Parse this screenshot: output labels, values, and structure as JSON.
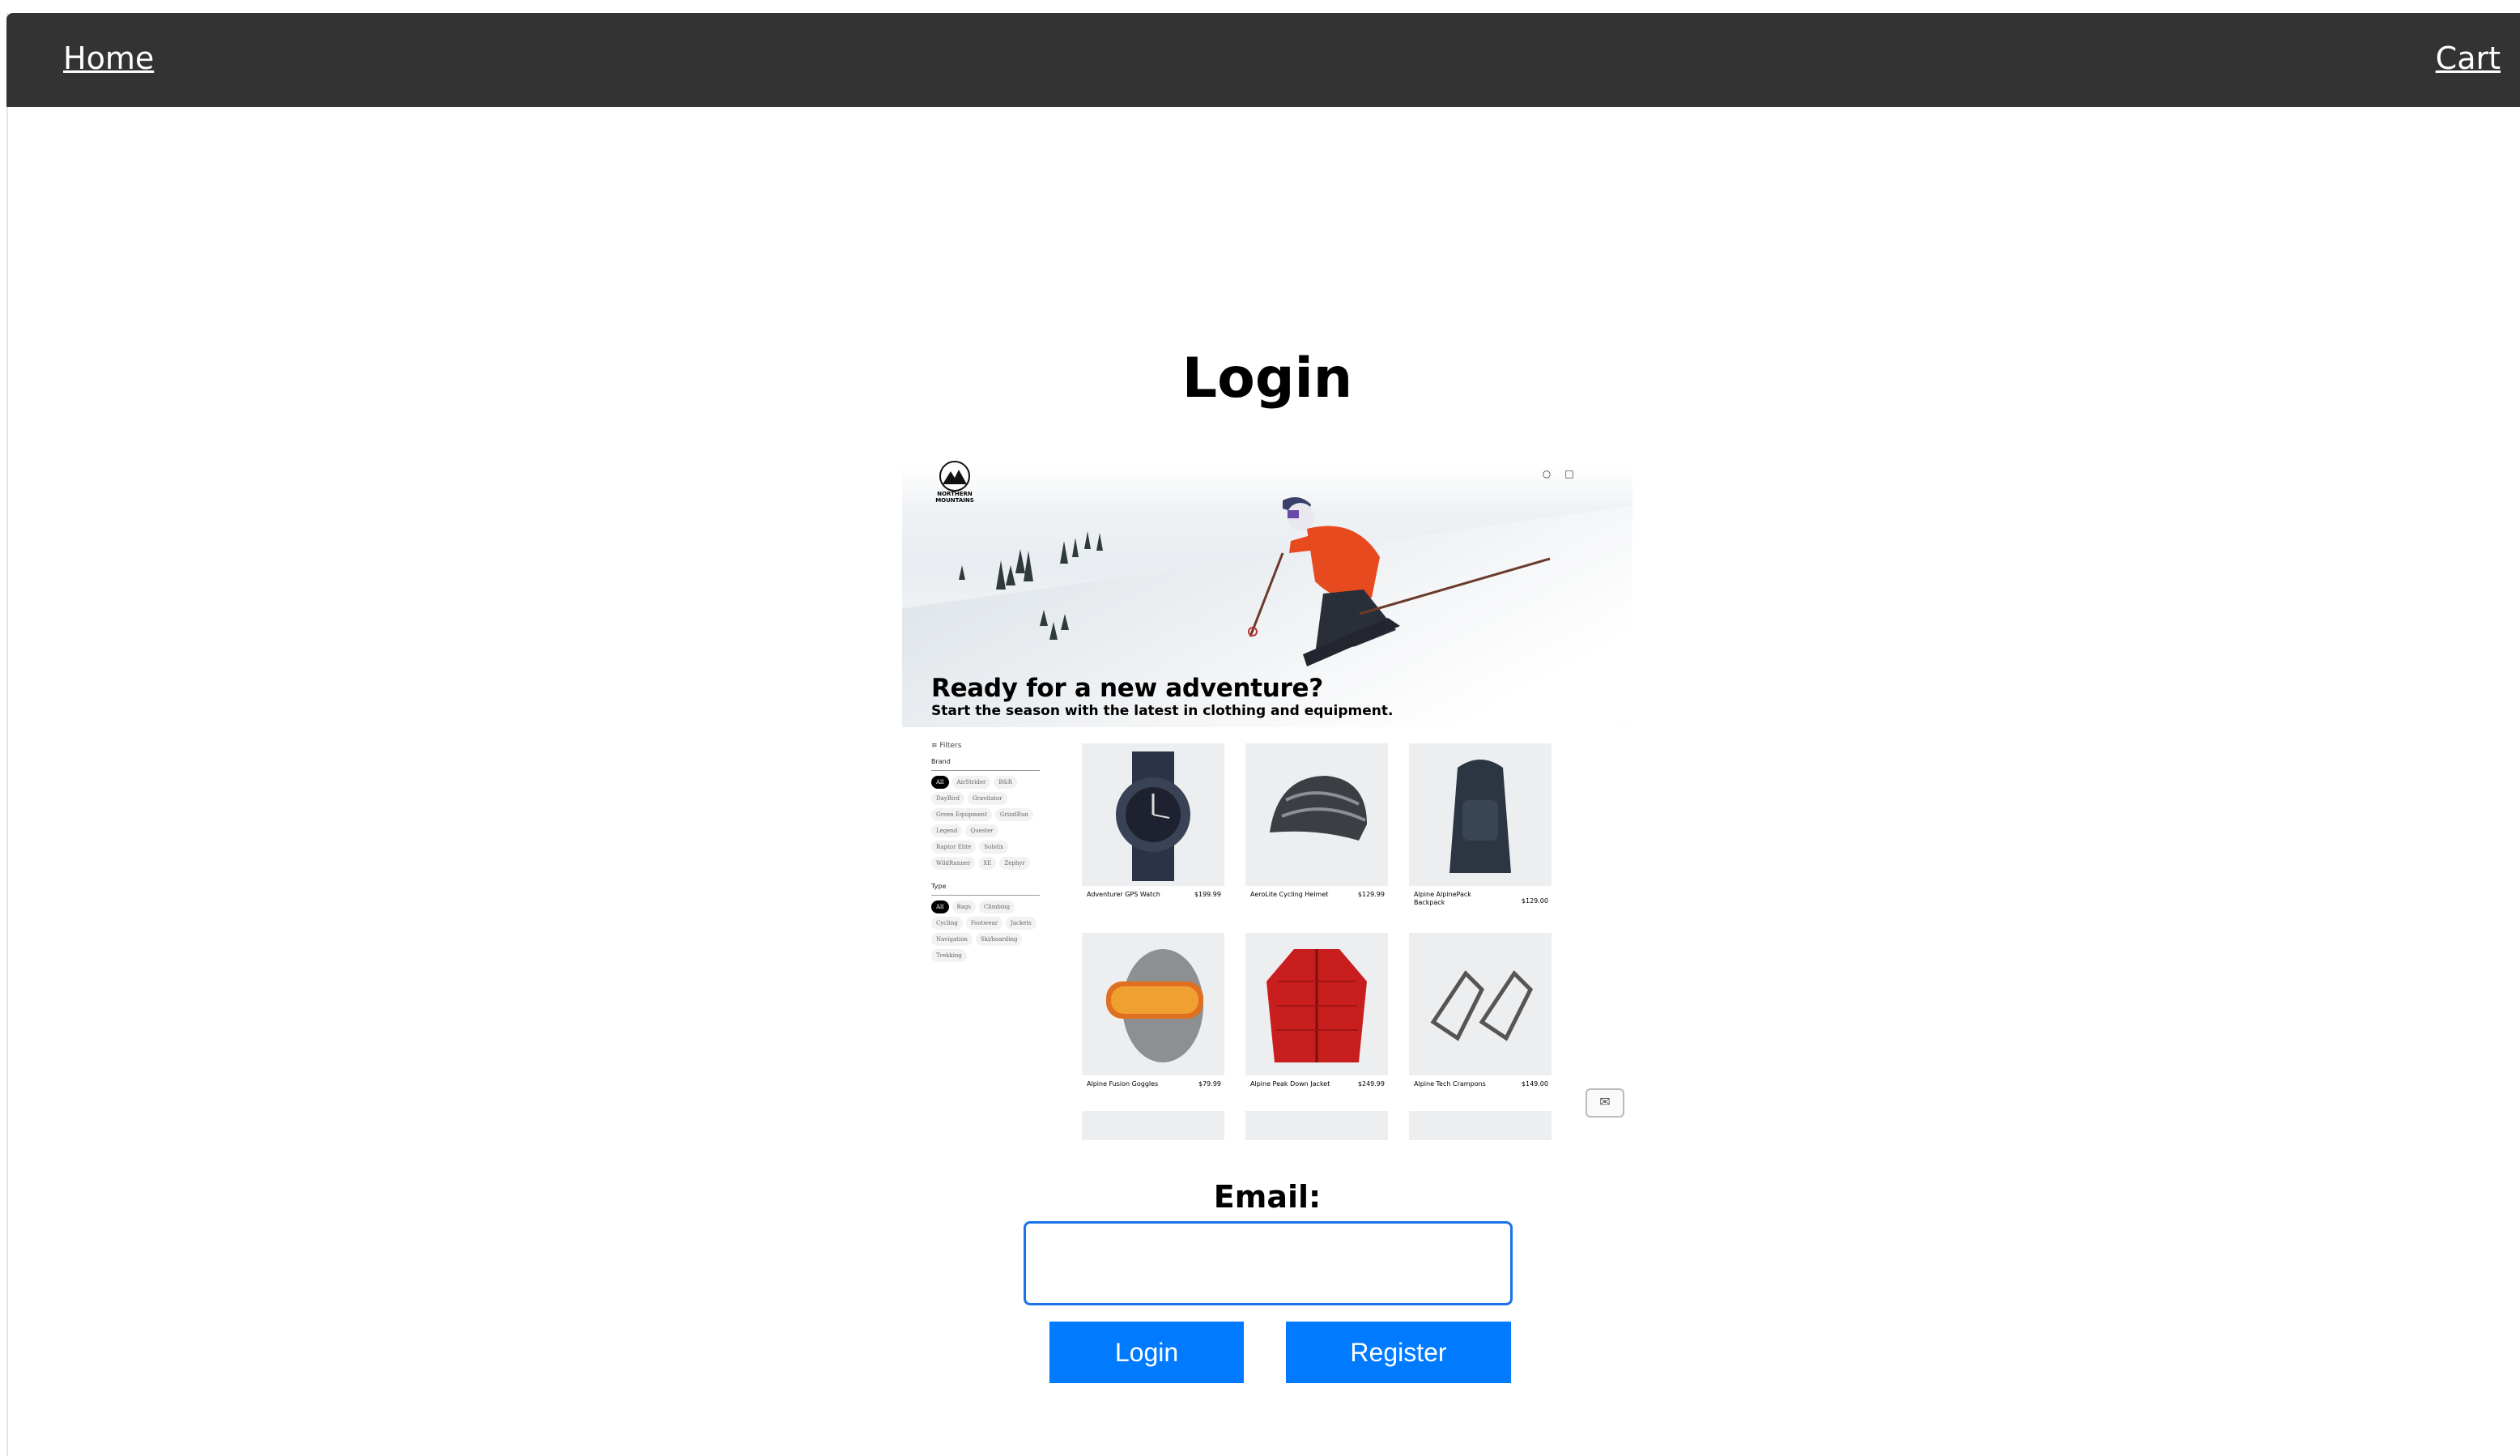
{
  "nav": {
    "home_label": "Home",
    "cart_label": "Cart",
    "bar_color": "#333333"
  },
  "page": {
    "title": "Login"
  },
  "preview": {
    "brand_logo_text": "NORTHERN MOUNTAINS",
    "hero_title": "Ready for a new adventure?",
    "hero_subtitle": "Start the season with the latest in clothing and equipment.",
    "filters_label": "Filters",
    "brand_heading": "Brand",
    "brands": [
      "All",
      "AirStrider",
      "B&R",
      "DayBird",
      "Gravitator",
      "Green Equipment",
      "GrizzlRun",
      "Legend",
      "Quester",
      "Raptor Elite",
      "Solstix",
      "WildRunner",
      "XE",
      "Zephyr"
    ],
    "type_heading": "Type",
    "types": [
      "All",
      "Bags",
      "Climbing",
      "Cycling",
      "Footwear",
      "Jackets",
      "Navigation",
      "Ski/boarding",
      "Trekking"
    ],
    "products": [
      {
        "name": "Adventurer GPS Watch",
        "price": "$199.99"
      },
      {
        "name": "AeroLite Cycling Helmet",
        "price": "$129.99"
      },
      {
        "name": "Alpine AlpinePack Backpack",
        "price": "$129.00"
      },
      {
        "name": "Alpine Fusion Goggles",
        "price": "$79.99"
      },
      {
        "name": "Alpine Peak Down Jacket",
        "price": "$249.99"
      },
      {
        "name": "Alpine Tech Crampons",
        "price": "$149.00"
      }
    ]
  },
  "form": {
    "email_label": "Email:",
    "email_value": "",
    "login_label": "Login",
    "register_label": "Register",
    "button_color": "#007bff",
    "input_border_color": "#1a73e8"
  }
}
